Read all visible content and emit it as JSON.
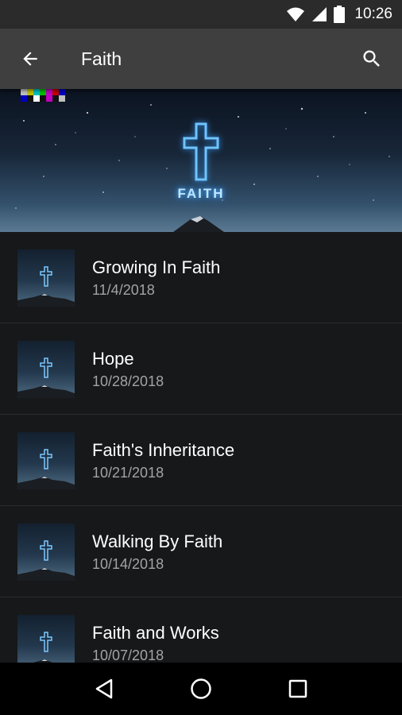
{
  "status_bar": {
    "time": "10:26",
    "icons": [
      "wifi-icon",
      "cellular-signal-icon",
      "battery-icon"
    ]
  },
  "app_bar": {
    "title": "Faith",
    "back_icon": "arrow-left-icon",
    "search_icon": "search-icon"
  },
  "hero": {
    "label": "FAITH",
    "accent_color": "#4fb2ff"
  },
  "episodes": [
    {
      "title": "Growing In Faith",
      "date": "11/4/2018"
    },
    {
      "title": "Hope",
      "date": "10/28/2018"
    },
    {
      "title": "Faith's Inheritance",
      "date": "10/21/2018"
    },
    {
      "title": "Walking By Faith",
      "date": "10/14/2018"
    },
    {
      "title": "Faith and Works",
      "date": "10/07/2018"
    }
  ],
  "nav_bar": {
    "icons": [
      "back-triangle-icon",
      "home-circle-icon",
      "recents-square-icon"
    ]
  },
  "colors": {
    "status_bar_bg": "#2b2b2b",
    "app_bar_bg": "#3f3f3f",
    "list_bg": "#17181a",
    "date_text": "#a3a3a3"
  }
}
